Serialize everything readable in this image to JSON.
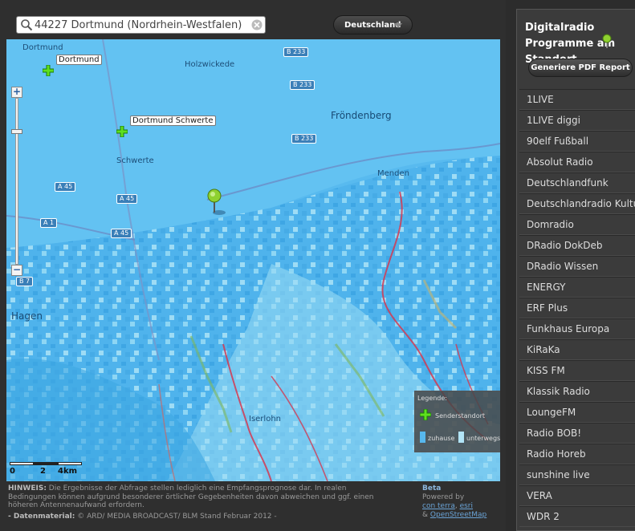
{
  "search": {
    "value": "44227 Dortmund (Nordrhein-Westfalen)"
  },
  "country_select": {
    "selected": "Deutschland"
  },
  "map": {
    "places": [
      {
        "name": "Dortmund"
      },
      {
        "name": "Holzwickede"
      },
      {
        "name": "Fröndenberg"
      },
      {
        "name": "Schwerte"
      },
      {
        "name": "Menden"
      },
      {
        "name": "Hagen"
      },
      {
        "name": "Iserlohn"
      }
    ],
    "roads": [
      "B 233",
      "B 233",
      "B 233",
      "A 45",
      "A 45",
      "A 1",
      "A 45",
      "B 7"
    ],
    "transmitters": [
      "Dortmund",
      "Dortmund Schwerte"
    ],
    "zoom": {
      "plus": "+",
      "minus": "−"
    },
    "scale": [
      "0",
      "2",
      "4km"
    ],
    "legend": {
      "title": "Legende:",
      "station": "Senderstandort",
      "home": "zuhause",
      "mobile": "unterwegs"
    }
  },
  "footer": {
    "hint_label": "HINWEIS:",
    "hint_text": " Die Ergebnisse der Abfrage stellen lediglich eine Empfangsprognose dar. In realen Bedingungen können aufgrund besonderer örtlicher Gegebenheiten davon abweichen und ggf. einen höheren Antennenaufwand erfordern.",
    "data_label": "- Datenmaterial:",
    "data_text": " © ARD/ MEDIA BROADCAST/ BLM Stand Februar 2012 -",
    "beta": "Beta",
    "powered": "Powered by",
    "link1": "con terra",
    "comma": ", ",
    "link2": "esri",
    "amp": "& ",
    "link3": "OpenStreetMap"
  },
  "sidebar": {
    "title": "Digitalradio Programme am Standort",
    "pdf_button": "Generiere PDF Report",
    "stations": [
      "1LIVE",
      "1LIVE diggi",
      "90elf Fußball",
      "Absolut Radio",
      "Deutschlandfunk",
      "Deutschlandradio Kultur",
      "Domradio",
      "DRadio DokDeb",
      "DRadio Wissen",
      "ENERGY",
      "ERF Plus",
      "Funkhaus Europa",
      "KiRaKa",
      "KISS FM",
      "Klassik Radio",
      "LoungeFM",
      "Radio BOB!",
      "Radio Horeb",
      "sunshine live",
      "VERA",
      "WDR 2"
    ]
  },
  "colors": {
    "coverage_home": "#57b8ee",
    "coverage_mobile": "#b2e4f6",
    "road": "#d23a52",
    "accent": "#77c62a"
  }
}
